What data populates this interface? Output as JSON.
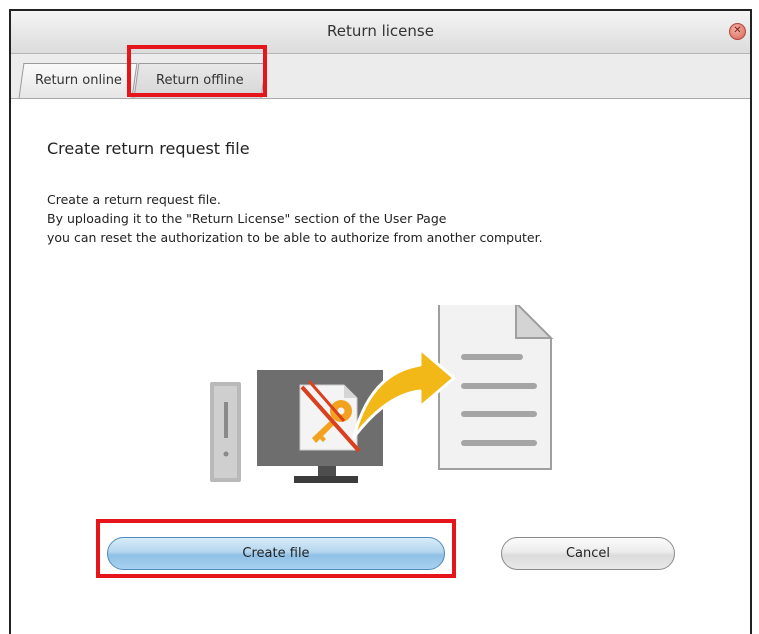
{
  "window": {
    "title": "Return license",
    "close_icon": "close-icon"
  },
  "tabs": [
    {
      "label": "Return online",
      "selected": false
    },
    {
      "label": "Return offline",
      "selected": true
    }
  ],
  "main": {
    "heading": "Create return request file",
    "description": [
      "Create a return request file.",
      "By uploading it to the \"Return License\" section of the User Page",
      "you can reset the authorization to be able to authorize from another computer."
    ]
  },
  "buttons": {
    "create_label": "Create file",
    "cancel_label": "Cancel"
  },
  "colors": {
    "highlight": "#e6151c",
    "arrow": "#f2b817",
    "key": "#f2a21f",
    "forbid": "#d9401e",
    "create_button": "#a9d1ef"
  }
}
